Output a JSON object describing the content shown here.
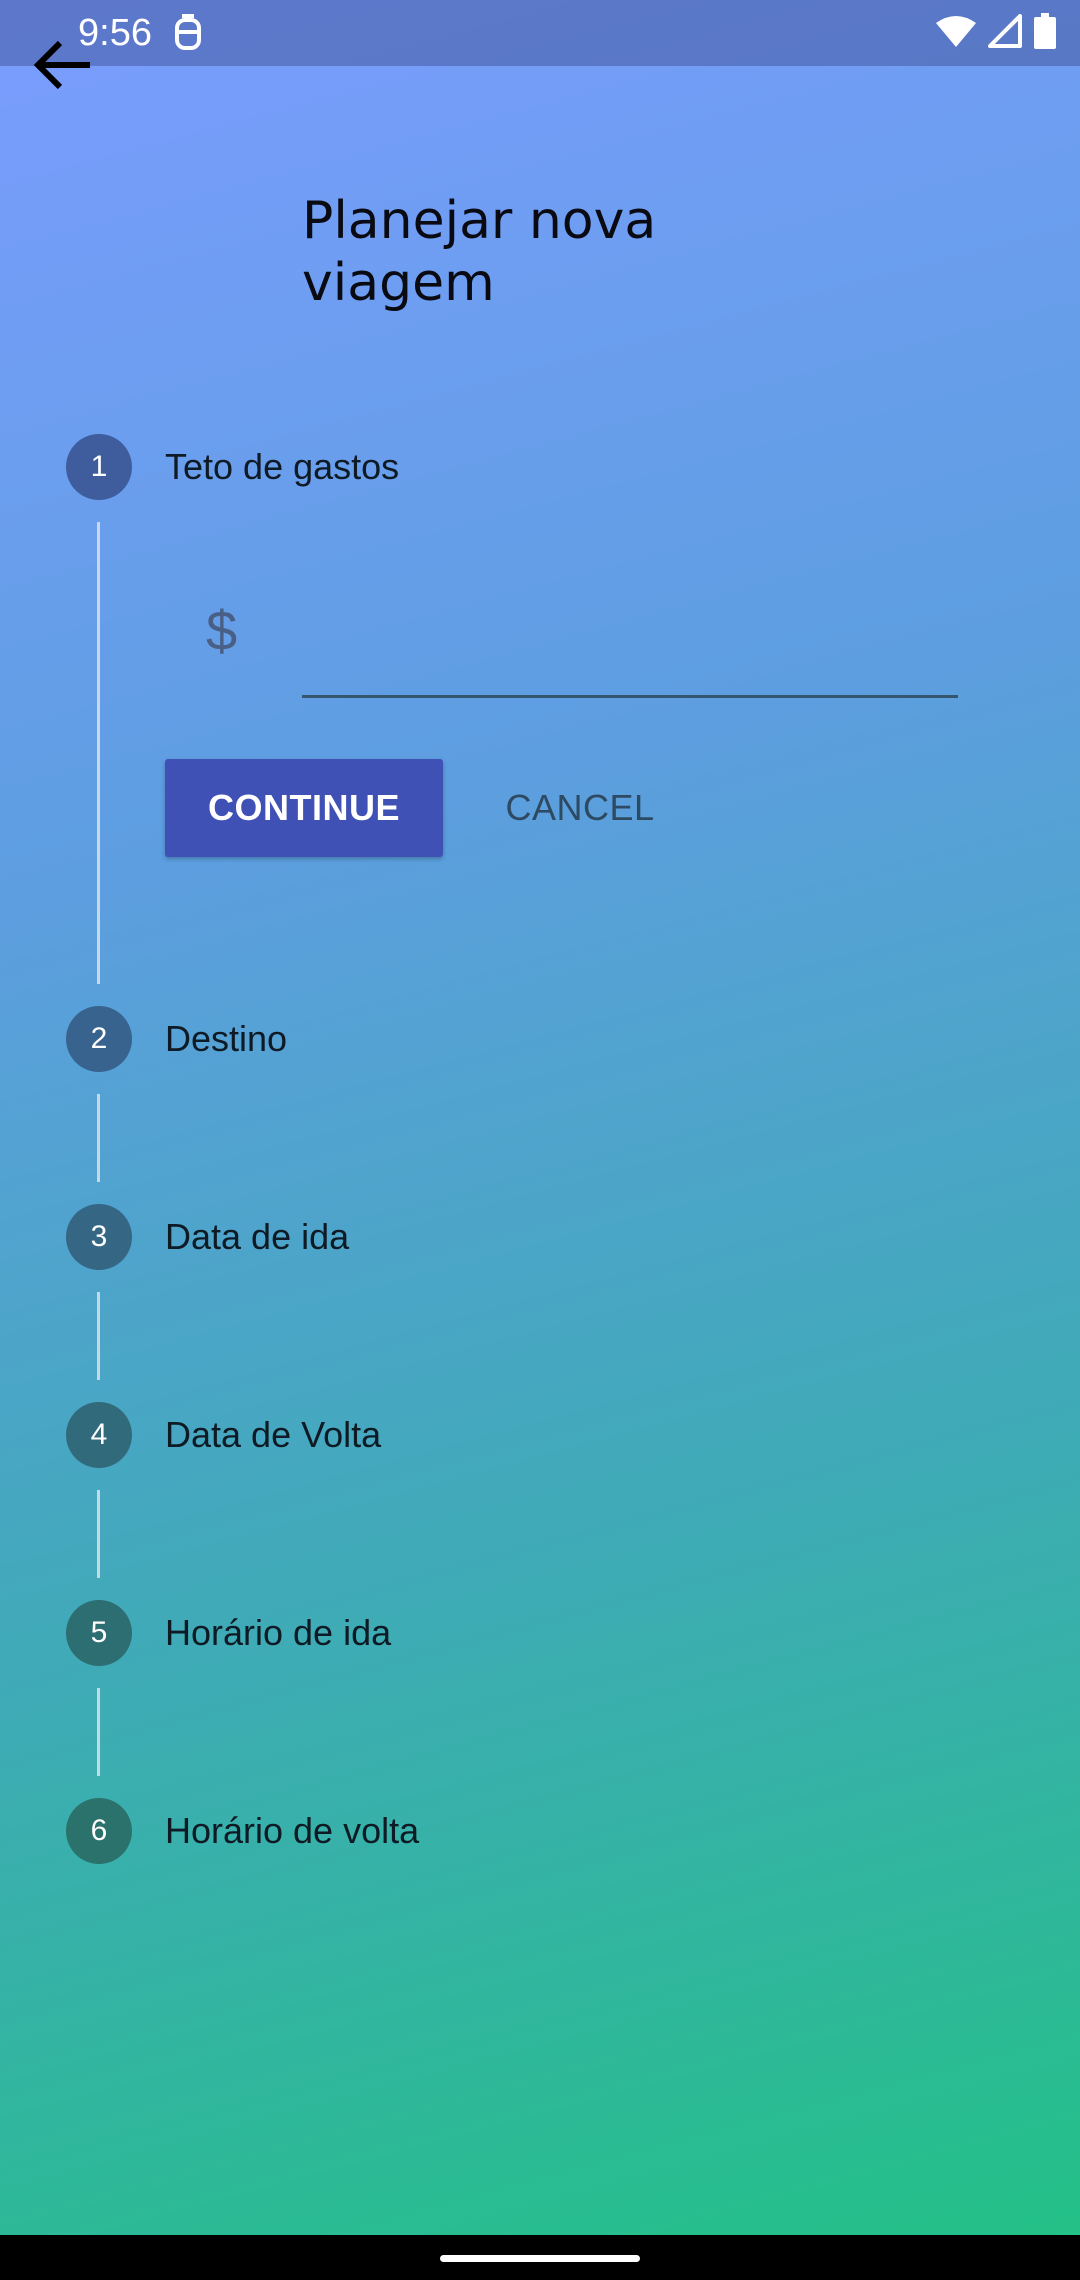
{
  "status_bar": {
    "time": "9:56"
  },
  "header": {
    "title_line1": "Planejar nova",
    "title_line2": "viagem"
  },
  "stepper": {
    "steps": [
      {
        "number": "1",
        "label": "Teto de gastos",
        "active": true
      },
      {
        "number": "2",
        "label": "Destino",
        "active": false
      },
      {
        "number": "3",
        "label": "Data de ida",
        "active": false
      },
      {
        "number": "4",
        "label": "Data de Volta",
        "active": false
      },
      {
        "number": "5",
        "label": "Horário de ida",
        "active": false
      },
      {
        "number": "6",
        "label": "Horário de volta",
        "active": false
      }
    ],
    "active_step_content": {
      "currency_symbol": "$",
      "amount_value": "",
      "continue_label": "CONTINUE",
      "cancel_label": "CANCEL"
    }
  },
  "colors": {
    "primary": "#3f51b5",
    "gradient_start": "#7b9dff",
    "gradient_end": "#22c285"
  }
}
